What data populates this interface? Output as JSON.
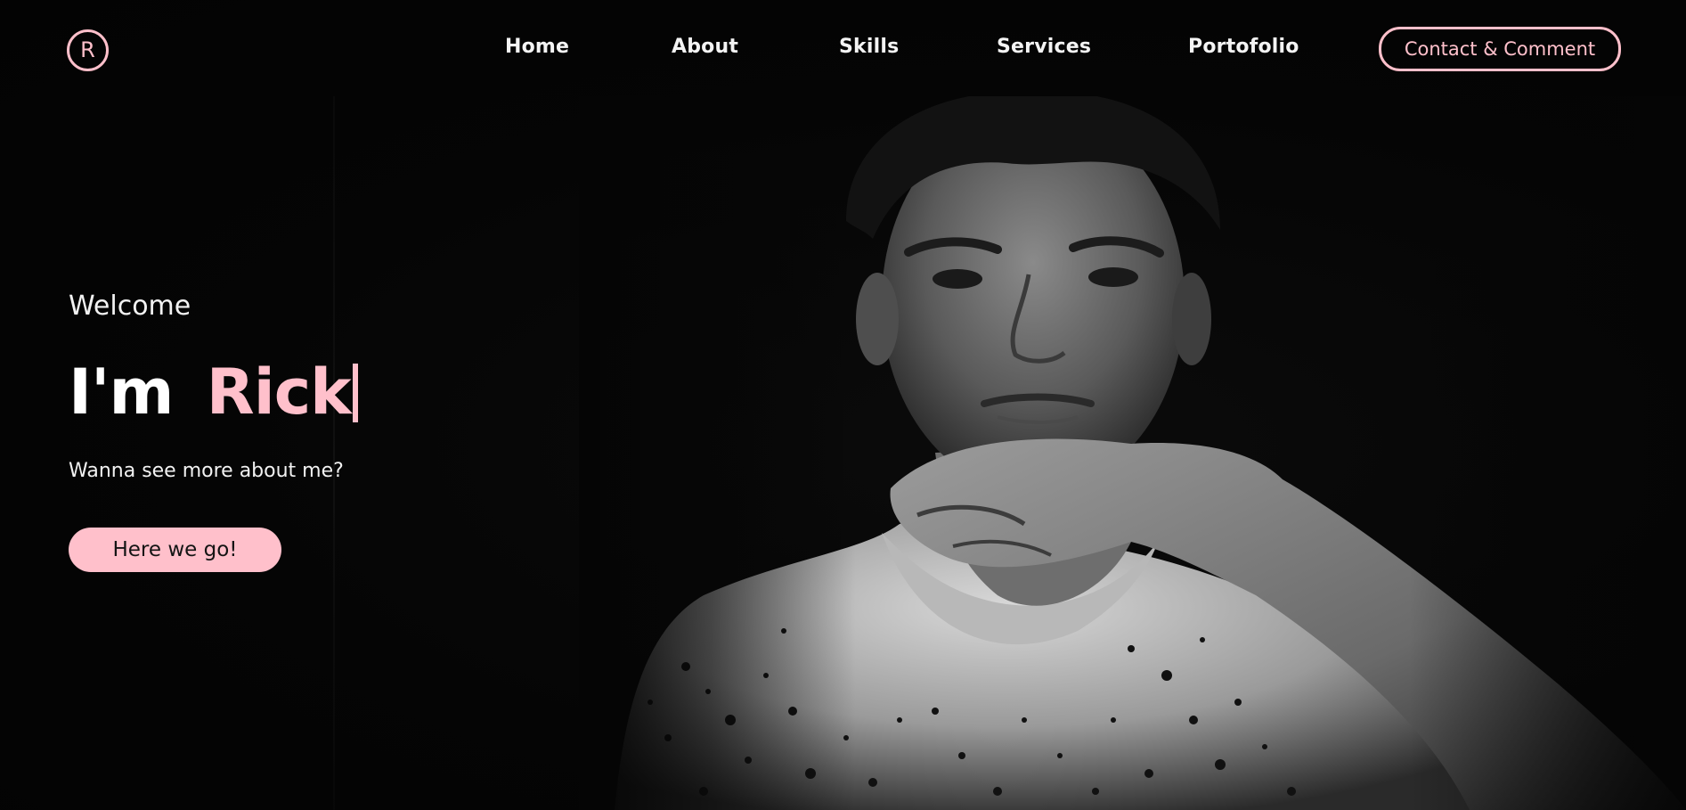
{
  "header": {
    "logo_letter": "R",
    "nav": {
      "home": "Home",
      "about": "About",
      "skills": "Skills",
      "services": "Services",
      "portfolio": "Portofolio"
    },
    "contact_label": "Contact & Comment"
  },
  "hero": {
    "welcome": "Welcome",
    "headline_prefix": "I'm",
    "headline_name": "Rick",
    "subtext": "Wanna see more about me?",
    "cta_label": "Here we go!"
  },
  "colors": {
    "accent": "#ffc0cb",
    "background": "#050505",
    "text": "#f4f4f4"
  },
  "media": {
    "portrait_icon": "portrait-photo"
  }
}
